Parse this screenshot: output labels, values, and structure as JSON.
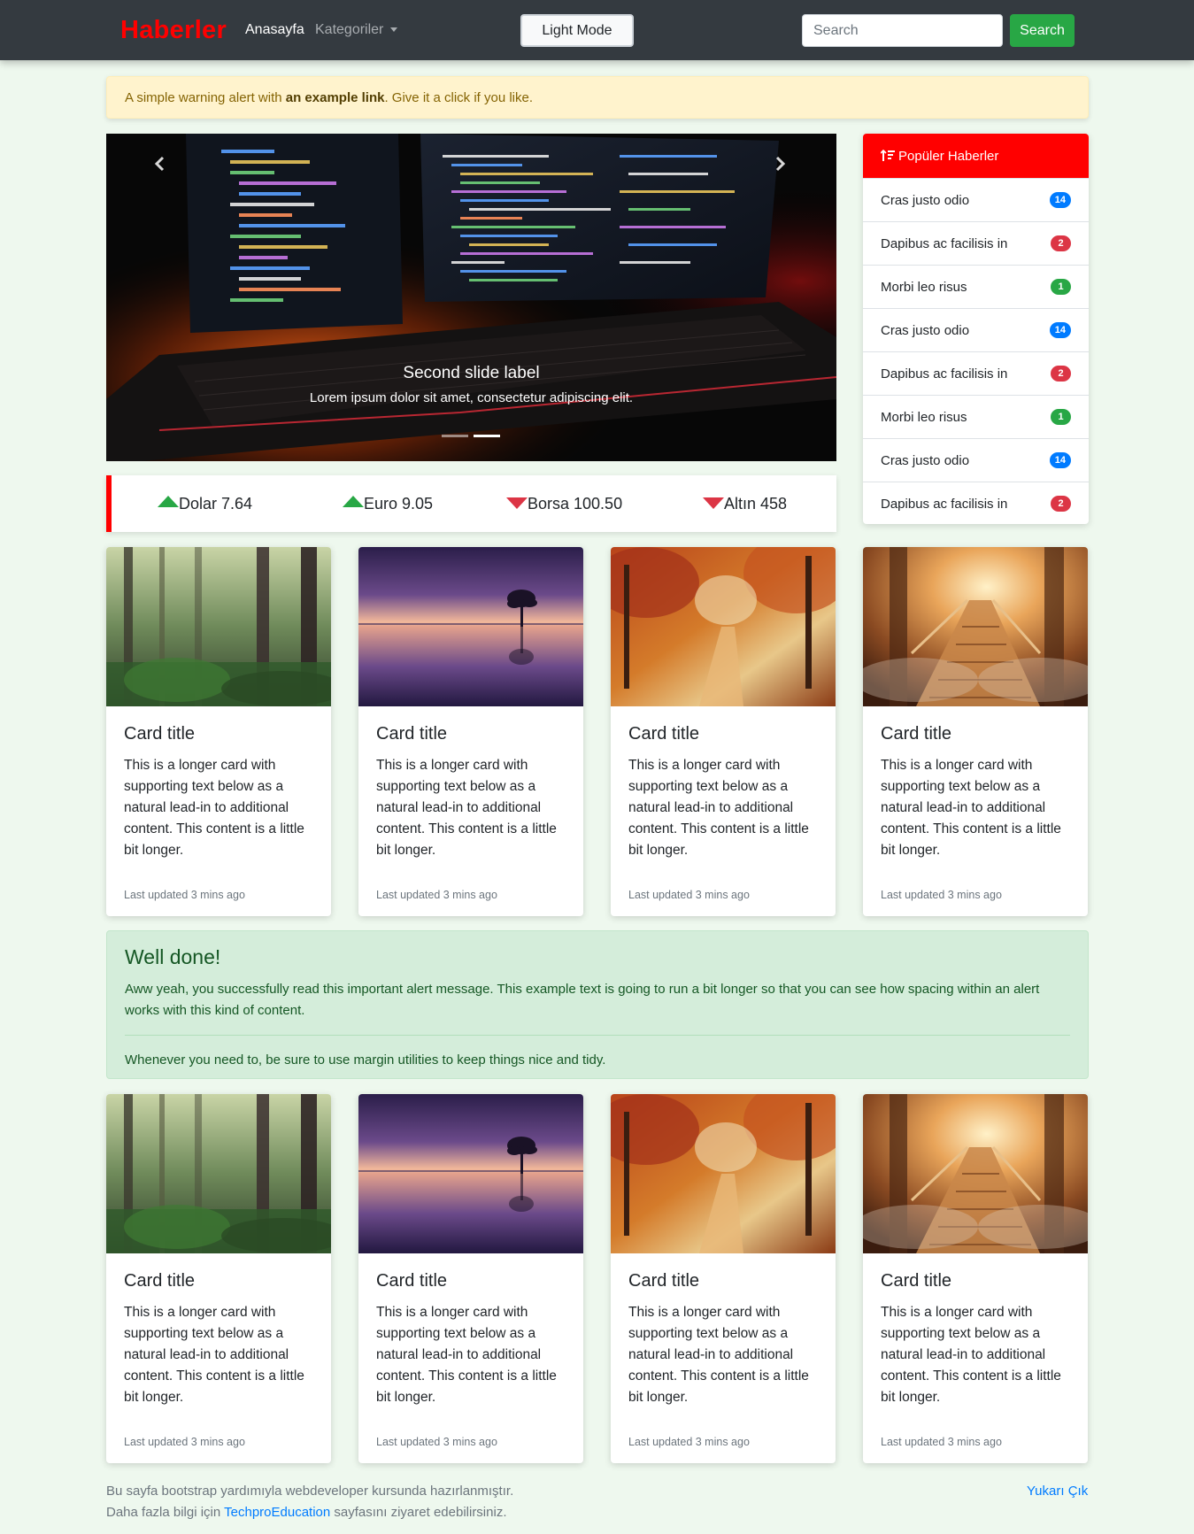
{
  "navbar": {
    "brand": "Haberler",
    "home": "Anasayfa",
    "categories": "Kategoriler",
    "mode_button": "Light Mode",
    "search_placeholder": "Search",
    "search_button": "Search"
  },
  "warning_alert": {
    "before": "A simple warning alert with ",
    "link": "an example link",
    "after": ". Give it a click if you like."
  },
  "carousel": {
    "title": "Second slide label",
    "text": "Lorem ipsum dolor sit amet, consectetur adipiscing elit.",
    "slides": 2,
    "active_slide": 2
  },
  "ticker": [
    {
      "label": "Dolar 7.64",
      "trend": "up"
    },
    {
      "label": "Euro 9.05",
      "trend": "up"
    },
    {
      "label": "Borsa 100.50",
      "trend": "down"
    },
    {
      "label": "Altın 458",
      "trend": "down"
    }
  ],
  "popular": {
    "title": "Popüler Haberler",
    "items": [
      {
        "label": "Cras justo odio",
        "count": "14",
        "color": "#007bff"
      },
      {
        "label": "Dapibus ac facilisis in",
        "count": "2",
        "color": "#dc3545"
      },
      {
        "label": "Morbi leo risus",
        "count": "1",
        "color": "#28a745"
      },
      {
        "label": "Cras justo odio",
        "count": "14",
        "color": "#007bff"
      },
      {
        "label": "Dapibus ac facilisis in",
        "count": "2",
        "color": "#dc3545"
      },
      {
        "label": "Morbi leo risus",
        "count": "1",
        "color": "#28a745"
      },
      {
        "label": "Cras justo odio",
        "count": "14",
        "color": "#007bff"
      },
      {
        "label": "Dapibus ac facilisis in",
        "count": "2",
        "color": "#dc3545"
      }
    ]
  },
  "cards": [
    {
      "title": "Card title",
      "text": "This is a longer card with supporting text below as a natural lead-in to additional content. This content is a little bit longer.",
      "updated": "Last updated 3 mins ago",
      "image": "forest-image"
    },
    {
      "title": "Card title",
      "text": "This is a longer card with supporting text below as a natural lead-in to additional content. This content is a little bit longer.",
      "updated": "Last updated 3 mins ago",
      "image": "lake-sunset-image"
    },
    {
      "title": "Card title",
      "text": "This is a longer card with supporting text below as a natural lead-in to additional content. This content is a little bit longer.",
      "updated": "Last updated 3 mins ago",
      "image": "autumn-path-image"
    },
    {
      "title": "Card title",
      "text": "This is a longer card with supporting text below as a natural lead-in to additional content. This content is a little bit longer.",
      "updated": "Last updated 3 mins ago",
      "image": "bridge-image"
    },
    {
      "title": "Card title",
      "text": "This is a longer card with supporting text below as a natural lead-in to additional content. This content is a little bit longer.",
      "updated": "Last updated 3 mins ago",
      "image": "forest-image"
    },
    {
      "title": "Card title",
      "text": "This is a longer card with supporting text below as a natural lead-in to additional content. This content is a little bit longer.",
      "updated": "Last updated 3 mins ago",
      "image": "lake-sunset-image"
    },
    {
      "title": "Card title",
      "text": "This is a longer card with supporting text below as a natural lead-in to additional content. This content is a little bit longer.",
      "updated": "Last updated 3 mins ago",
      "image": "autumn-path-image"
    },
    {
      "title": "Card title",
      "text": "This is a longer card with supporting text below as a natural lead-in to additional content. This content is a little bit longer.",
      "updated": "Last updated 3 mins ago",
      "image": "bridge-image"
    }
  ],
  "success_alert": {
    "heading": "Well done!",
    "text": "Aww yeah, you successfully read this important alert message. This example text is going to run a bit longer so that you can see how spacing within an alert works with this kind of content.",
    "note": "Whenever you need to, be sure to use margin utilities to keep things nice and tidy."
  },
  "footer": {
    "line1": "Bu sayfa bootstrap yardımıyla webdeveloper kursunda hazırlanmıştır.",
    "line2_before": "Daha fazla bilgi için ",
    "line2_link": "TechproEducation",
    "line2_after": " sayfasını ziyaret edebilirsiniz.",
    "back_to_top": "Yukarı Çık"
  },
  "colors": {
    "navbar_bg": "#343a40",
    "brand": "#ff0000",
    "page_bg": "#eef8ee",
    "search_button": "#28a745",
    "popular_header": "#ff0000",
    "up": "#28a745",
    "down": "#dc3545"
  }
}
